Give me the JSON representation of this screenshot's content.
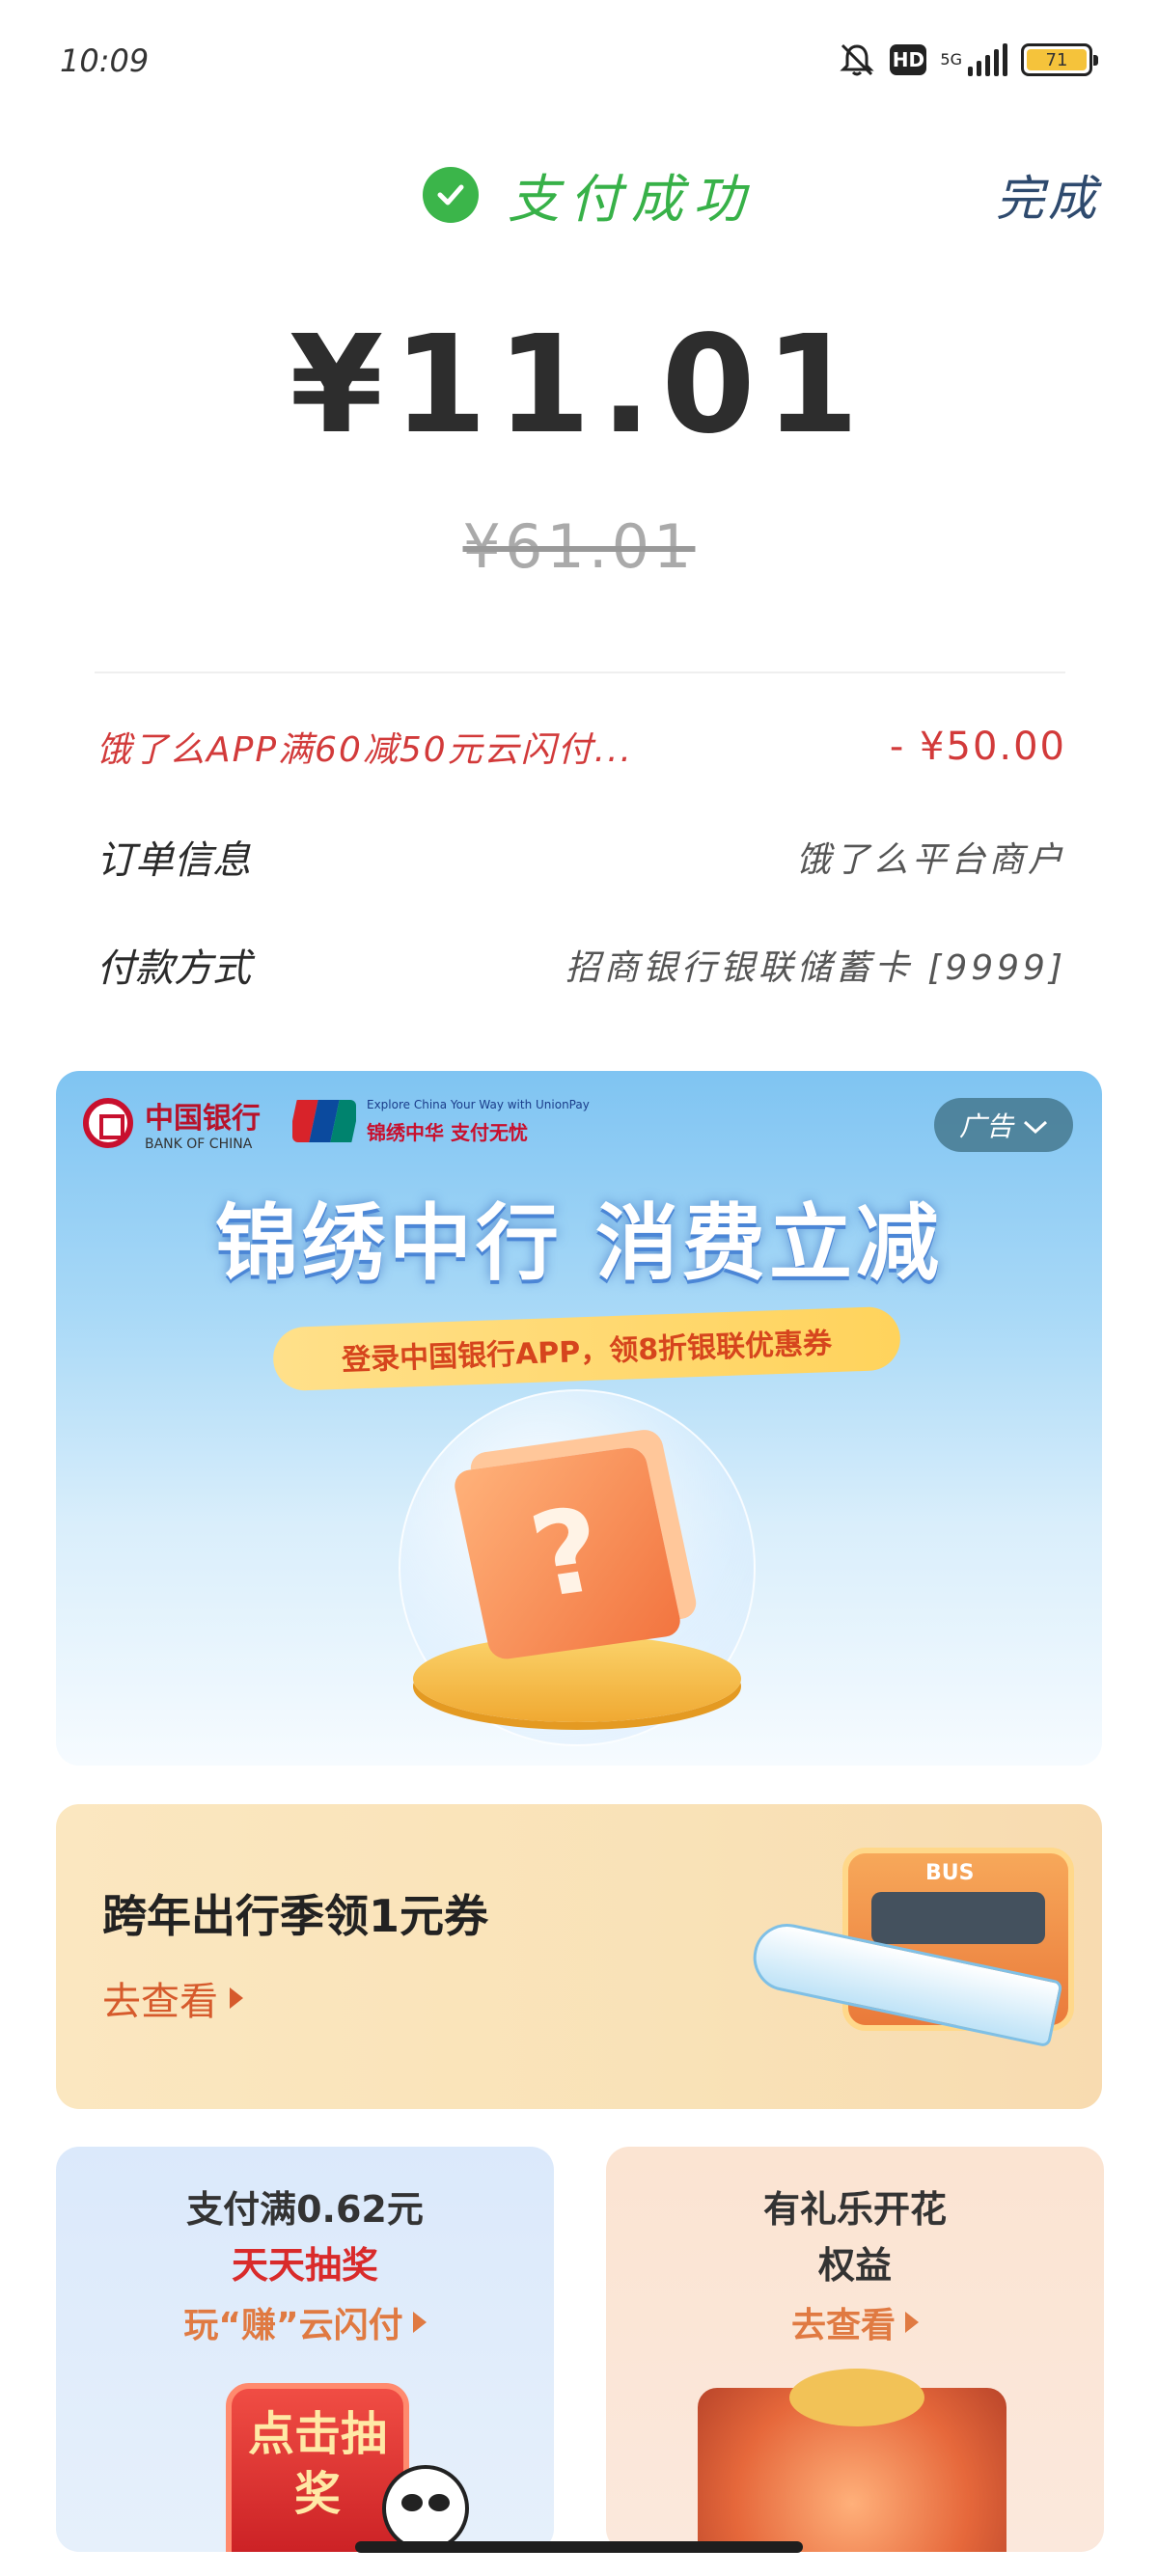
{
  "status_bar": {
    "time": "10:09",
    "network": "5G",
    "hd_label": "HD",
    "battery_level": "71"
  },
  "header": {
    "status_text": "支付成功",
    "done_label": "完成"
  },
  "payment": {
    "amount": "¥11.01",
    "original_amount": "¥61.01"
  },
  "details": [
    {
      "label": "饿了么APP满60减50元云闪付...",
      "value": "- ¥50.00"
    },
    {
      "label": "订单信息",
      "value": "饿了么平台商户"
    },
    {
      "label": "付款方式",
      "value": "招商银行银联储蓄卡 [9999]"
    }
  ],
  "ad_banner": {
    "bank_name_cn": "中国银行",
    "bank_name_en": "BANK OF CHINA",
    "unionpay_small": "Explore China Your Way with UnionPay",
    "unionpay_slogan": "锦绣中华 支付无忧",
    "ad_tag": "广告",
    "title": "锦绣中行 消费立减",
    "ribbon": "登录中国银行APP，领8折银联优惠券"
  },
  "travel_card": {
    "title": "跨年出行季领1元券",
    "link": "去查看",
    "bus_label": "BUS"
  },
  "card_left": {
    "line1": "支付满0.62元",
    "line2": "天天抽奖",
    "link": "玩“赚”云闪付",
    "button": "点击抽奖"
  },
  "card_right": {
    "line1": "有礼乐开花",
    "line2": "权益",
    "link": "去查看"
  },
  "colors": {
    "success_green": "#37b148",
    "discount_red": "#d23a3a",
    "link_orange": "#d65a2c"
  }
}
